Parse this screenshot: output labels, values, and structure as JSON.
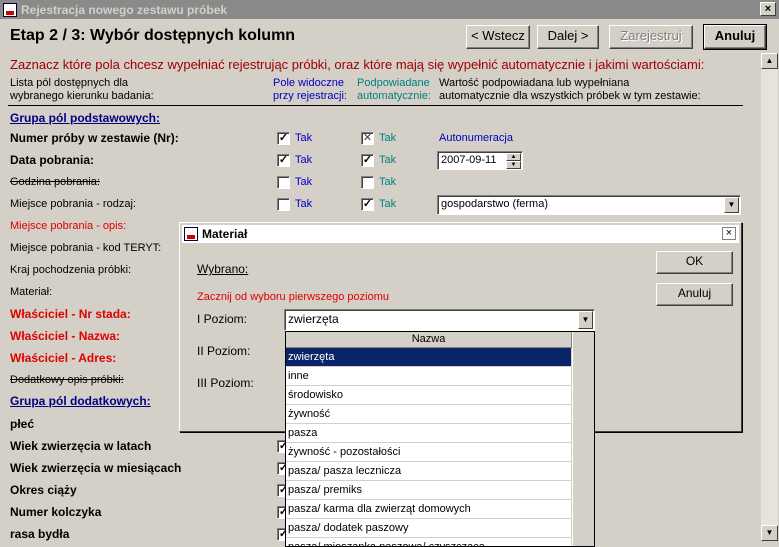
{
  "window": {
    "title": "Rejestracja nowego zestawu próbek",
    "close": "×"
  },
  "page_title": "Etap 2 / 3: Wybór dostępnych kolumn",
  "buttons": {
    "back": "< Wstecz",
    "next": "Dalej >",
    "register": "Zarejestruj",
    "cancel": "Anuluj"
  },
  "instruction": "Zaznacz które pola chcesz wypełniać rejestrując próbki, oraz które mają się wypełnić automatycznie i jakimi wartościami:",
  "columns": {
    "fields": [
      "Lista pól dostępnych dla",
      "wybranego kierunku badania:"
    ],
    "visible": [
      "Pole widoczne",
      "przy rejestracji:"
    ],
    "auto": [
      "Podpowiadane",
      "automatycznie:"
    ],
    "value": [
      "Wartość podpowiadana lub wypełniana",
      "automatycznie dla wszystkich próbek w tym zestawie:"
    ]
  },
  "tak": "Tak",
  "rows": {
    "group_basic": "Grupa pól podstawowych:",
    "nr": "Numer próby w zestawie (Nr):",
    "nr_value": "Autonumeracja",
    "date": "Data pobrania:",
    "date_value": "2007-09-11",
    "time": "Godzina pobrania:",
    "place_type": "Miejsce pobrania - rodzaj:",
    "place_type_value": "gospodarstwo (ferma)",
    "place_desc": "Miejsce pobrania - opis:",
    "teryt": "Miejsce pobrania - kod TERYT:",
    "country": "Kraj pochodzenia próbki:",
    "material": "Materiał:",
    "owner_nr": "Właściciel -  Nr stada:",
    "owner_name": "Właściciel - Nazwa:",
    "owner_addr": "Właściciel - Adres:",
    "extra_desc": "Dodatkowy opis próbki:",
    "group_extra": "Grupa pól dodatkowych:",
    "sex": "płeć",
    "age_years": "Wiek zwierzęcia w latach",
    "age_months": "Wiek zwierzęcia w miesiącach",
    "pregnancy": "Okres ciąży",
    "earring": "Numer kolczyka",
    "breed": "rasa bydła"
  },
  "dialog": {
    "title": "Materiał",
    "close": "×",
    "selected_label": "Wybrano:",
    "hint": "Zacznij od wyboru pierwszego poziomu",
    "level1": "I Poziom:",
    "level2": "II Poziom:",
    "level3": "III Poziom:",
    "level1_value": "zwierzęta",
    "ok": "OK",
    "cancel": "Anuluj"
  },
  "dropdown": {
    "header": "Nazwa",
    "items": [
      "zwierzęta",
      "inne",
      "środowisko",
      "żywność",
      "pasza",
      "żywność - pozostałości",
      "pasza/ pasza lecznicza",
      "pasza/ premiks",
      "pasza/ karma dla zwierząt domowych",
      "pasza/ dodatek paszowy",
      "pasza/ mieszanka paszowa/ czyszczaca"
    ],
    "selected_index": 0
  },
  "colors": {
    "instruction": "#a00000",
    "teal": "#008080",
    "required": "#e00000",
    "group": "#000080",
    "selection": "#0a246a"
  },
  "icons": {
    "check": "✓",
    "cross": "✕",
    "down": "▼",
    "up": "▲"
  }
}
